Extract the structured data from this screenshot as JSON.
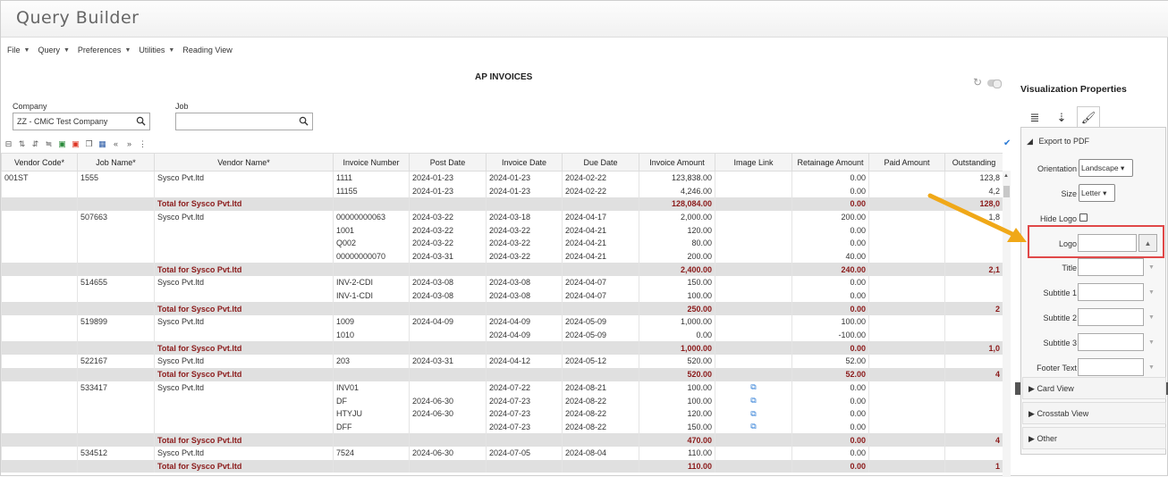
{
  "app": {
    "title": "Query Builder"
  },
  "menu": [
    {
      "label": "File",
      "caret": true
    },
    {
      "label": "Query",
      "caret": true
    },
    {
      "label": "Preferences",
      "caret": true
    },
    {
      "label": "Utilities",
      "caret": true
    },
    {
      "label": "Reading View",
      "caret": false
    }
  ],
  "report": {
    "title": "AP INVOICES",
    "subtitle": "                              "
  },
  "filters": {
    "company_label": "Company",
    "company_value": "ZZ - CMiC Test Company",
    "job_label": "Job",
    "job_value": ""
  },
  "table": {
    "columns": [
      "Vendor Code*",
      "Job Name*",
      "Vendor Name*",
      "Invoice Number",
      "Post Date",
      "Invoice Date",
      "Due Date",
      "Invoice Amount",
      "Image Link",
      "Retainage Amount",
      "Paid Amount",
      "Outstanding"
    ],
    "rows": [
      {
        "type": "data",
        "cells": [
          "001ST",
          "1555",
          "Sysco Pvt.ltd",
          "1111",
          "2024-01-23",
          "2024-01-23",
          "2024-02-22",
          "123,838.00",
          "",
          "0.00",
          "",
          "123,8"
        ]
      },
      {
        "type": "data",
        "cells": [
          "",
          "",
          "",
          "11155",
          "2024-01-23",
          "2024-01-23",
          "2024-02-22",
          "4,246.00",
          "",
          "0.00",
          "",
          "4,2"
        ]
      },
      {
        "type": "total",
        "cells": [
          "",
          "",
          "Total for Sysco Pvt.ltd",
          "",
          "",
          "",
          "",
          "128,084.00",
          "",
          "0.00",
          "",
          "128,0"
        ]
      },
      {
        "type": "data",
        "cells": [
          "",
          "507663",
          "Sysco Pvt.ltd",
          "00000000063",
          "2024-03-22",
          "2024-03-18",
          "2024-04-17",
          "2,000.00",
          "",
          "200.00",
          "",
          "1,8"
        ]
      },
      {
        "type": "data",
        "cells": [
          "",
          "",
          "",
          "1001",
          "2024-03-22",
          "2024-03-22",
          "2024-04-21",
          "120.00",
          "",
          "0.00",
          "",
          ""
        ]
      },
      {
        "type": "data",
        "cells": [
          "",
          "",
          "",
          "Q002",
          "2024-03-22",
          "2024-03-22",
          "2024-04-21",
          "80.00",
          "",
          "0.00",
          "",
          ""
        ]
      },
      {
        "type": "data",
        "cells": [
          "",
          "",
          "",
          "00000000070",
          "2024-03-31",
          "2024-03-22",
          "2024-04-21",
          "200.00",
          "",
          "40.00",
          "",
          ""
        ]
      },
      {
        "type": "total",
        "cells": [
          "",
          "",
          "Total for Sysco Pvt.ltd",
          "",
          "",
          "",
          "",
          "2,400.00",
          "",
          "240.00",
          "",
          "2,1"
        ]
      },
      {
        "type": "data",
        "cells": [
          "",
          "514655",
          "Sysco Pvt.ltd",
          "INV-2-CDI",
          "2024-03-08",
          "2024-03-08",
          "2024-04-07",
          "150.00",
          "",
          "0.00",
          "",
          ""
        ]
      },
      {
        "type": "data",
        "cells": [
          "",
          "",
          "",
          "INV-1-CDI",
          "2024-03-08",
          "2024-03-08",
          "2024-04-07",
          "100.00",
          "",
          "0.00",
          "",
          ""
        ]
      },
      {
        "type": "total",
        "cells": [
          "",
          "",
          "Total for Sysco Pvt.ltd",
          "",
          "",
          "",
          "",
          "250.00",
          "",
          "0.00",
          "",
          "2"
        ]
      },
      {
        "type": "data",
        "cells": [
          "",
          "519899",
          "Sysco Pvt.ltd",
          "1009",
          "2024-04-09",
          "2024-04-09",
          "2024-05-09",
          "1,000.00",
          "",
          "100.00",
          "",
          ""
        ]
      },
      {
        "type": "data",
        "cells": [
          "",
          "",
          "",
          "1010",
          "",
          "2024-04-09",
          "2024-05-09",
          "0.00",
          "",
          "-100.00",
          "",
          ""
        ]
      },
      {
        "type": "total",
        "cells": [
          "",
          "",
          "Total for Sysco Pvt.ltd",
          "",
          "",
          "",
          "",
          "1,000.00",
          "",
          "0.00",
          "",
          "1,0"
        ]
      },
      {
        "type": "data",
        "cells": [
          "",
          "522167",
          "Sysco Pvt.ltd",
          "203",
          "2024-03-31",
          "2024-04-12",
          "2024-05-12",
          "520.00",
          "",
          "52.00",
          "",
          ""
        ]
      },
      {
        "type": "total",
        "cells": [
          "",
          "",
          "Total for Sysco Pvt.ltd",
          "",
          "",
          "",
          "",
          "520.00",
          "",
          "52.00",
          "",
          "4"
        ]
      },
      {
        "type": "data",
        "link": true,
        "cells": [
          "",
          "533417",
          "Sysco Pvt.ltd",
          "INV01",
          "",
          "2024-07-22",
          "2024-08-21",
          "100.00",
          "",
          "0.00",
          "",
          ""
        ]
      },
      {
        "type": "data",
        "link": true,
        "cells": [
          "",
          "",
          "",
          "DF",
          "2024-06-30",
          "2024-07-23",
          "2024-08-22",
          "100.00",
          "",
          "0.00",
          "",
          ""
        ]
      },
      {
        "type": "data",
        "link": true,
        "cells": [
          "",
          "",
          "",
          "HTYJU",
          "2024-06-30",
          "2024-07-23",
          "2024-08-22",
          "120.00",
          "",
          "0.00",
          "",
          ""
        ]
      },
      {
        "type": "data",
        "link": true,
        "cells": [
          "",
          "",
          "",
          "DFF",
          "",
          "2024-07-23",
          "2024-08-22",
          "150.00",
          "",
          "0.00",
          "",
          ""
        ]
      },
      {
        "type": "total",
        "cells": [
          "",
          "",
          "Total for Sysco Pvt.ltd",
          "",
          "",
          "",
          "",
          "470.00",
          "",
          "0.00",
          "",
          "4"
        ]
      },
      {
        "type": "data",
        "cells": [
          "",
          "534512",
          "Sysco Pvt.ltd",
          "7524",
          "2024-06-30",
          "2024-07-05",
          "2024-08-04",
          "110.00",
          "",
          "0.00",
          "",
          ""
        ]
      },
      {
        "type": "total",
        "cells": [
          "",
          "",
          "Total for Sysco Pvt.ltd",
          "",
          "",
          "",
          "",
          "110.00",
          "",
          "0.00",
          "",
          "1"
        ]
      }
    ]
  },
  "panel": {
    "title": "Visualization Properties",
    "export_section": "Export to PDF",
    "orientation_label": "Orientation",
    "orientation_value": "Landscape",
    "size_label": "Size",
    "size_value": "Letter",
    "hide_logo_label": "Hide Logo",
    "logo_label": "Logo",
    "title_label": "Title",
    "subtitle1_label": "Subtitle 1",
    "subtitle2_label": "Subtitle 2",
    "subtitle3_label": "Subtitle 3",
    "footer_label": "Footer Text",
    "card_view": "Card View",
    "crosstab_view": "Crosstab View",
    "other": "Other"
  },
  "colors": {
    "total_text": "#8b1a1a",
    "highlight": "#e04848",
    "arrow": "#f0a818",
    "link": "#2a7ad5"
  }
}
